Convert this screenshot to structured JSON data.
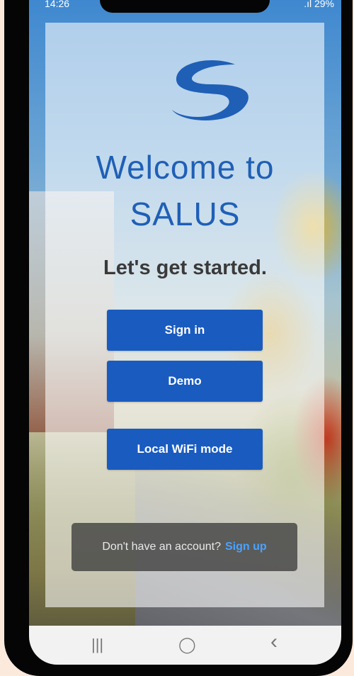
{
  "status_bar": {
    "time": "14:26",
    "left_icons": "⊙",
    "battery": "29%",
    "signal": ".ıl"
  },
  "app": {
    "welcome_line1": "Welcome to",
    "welcome_line2": "SALUS",
    "tagline": "Let's get started."
  },
  "buttons": {
    "sign_in": "Sign in",
    "demo": "Demo",
    "local_wifi": "Local WiFi mode"
  },
  "signup": {
    "prompt": "Don't have an account?",
    "link": "Sign up"
  },
  "navbar": {
    "recents_icon": "|||",
    "home_icon": "◯",
    "back_icon": "‹"
  },
  "colors": {
    "brand_blue": "#1a5bbf",
    "heading_blue": "#1f5fb6",
    "link_blue": "#4aa3ff"
  }
}
